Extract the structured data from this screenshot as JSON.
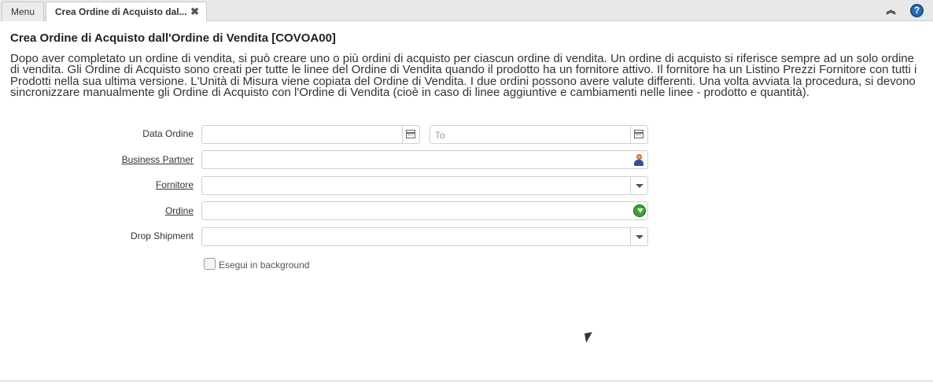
{
  "tabs": {
    "menu_label": "Menu",
    "active_label": "Crea Ordine di Acquisto dal...",
    "close_glyph": "✖"
  },
  "toolbar": {
    "collapse_glyph": "︽",
    "help_glyph": "?"
  },
  "page": {
    "title": "Crea Ordine di Acquisto dall'Ordine di Vendita [COVOA00]",
    "description": "Dopo aver completato un ordine di vendita, si può creare uno o più ordini di acquisto per ciascun ordine di vendita. Un ordine di acquisto si riferisce sempre ad un solo ordine di vendita. Gli Ordine di Acquisto sono creati per tutte le linee del Ordine di Vendita quando il prodotto ha un fornitore attivo. Il fornitore ha un Listino Prezzi Fornitore con tutti i Prodotti nella sua ultima versione. L'Unità di Misura viene copiata del Ordine di Vendita. I due ordini possono avere valute differenti. Una volta avviata la procedura, si devono sincronizzare manualmente gli Ordine di Acquisto con l'Ordine di Vendita (cioè in caso di linee aggiuntive e cambiamenti nelle linee - prodotto e quantità)."
  },
  "form": {
    "date_order": {
      "label": "Data Ordine",
      "from_value": "",
      "to_placeholder": "To"
    },
    "business_partner": {
      "label": "Business Partner",
      "value": ""
    },
    "vendor": {
      "label": "Fornitore",
      "value": ""
    },
    "order": {
      "label": "Ordine",
      "value": ""
    },
    "drop_shipment": {
      "label": "Drop Shipment",
      "value": ""
    },
    "background": {
      "label": "Esegui in background",
      "checked": false
    }
  },
  "colors": {
    "accent": "#2a6bb3",
    "zoom_green": "#3ea03e"
  }
}
